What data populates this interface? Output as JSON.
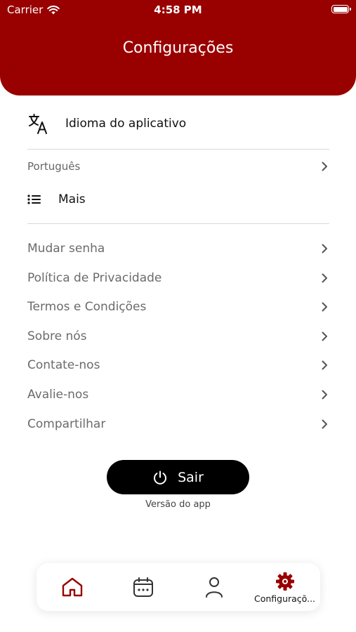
{
  "status_bar": {
    "carrier": "Carrier",
    "time": "4:58 PM"
  },
  "header": {
    "title": "Configurações"
  },
  "language": {
    "section_label": "Idioma do aplicativo",
    "current_value": "Português",
    "icon": "translate-icon"
  },
  "more": {
    "section_label": "Mais",
    "icon": "list-icon"
  },
  "menu_items": [
    {
      "label": "Mudar senha"
    },
    {
      "label": "Política de Privacidade"
    },
    {
      "label": "Termos e Condições"
    },
    {
      "label": "Sobre nós"
    },
    {
      "label": "Contate-nos"
    },
    {
      "label": "Avalie-nos"
    },
    {
      "label": "Compartilhar"
    }
  ],
  "logout": {
    "label": "Sair",
    "icon": "power-icon"
  },
  "version": {
    "label": "Versão do app"
  },
  "tab_bar": {
    "tabs": [
      {
        "icon": "home-icon"
      },
      {
        "icon": "calendar-icon"
      },
      {
        "icon": "user-icon"
      },
      {
        "icon": "gear-icon",
        "label": "Configuraçõ..."
      }
    ],
    "active_index": 3
  },
  "colors": {
    "brand": "#990000",
    "text_muted": "#6b6b6b",
    "button": "#000000"
  }
}
